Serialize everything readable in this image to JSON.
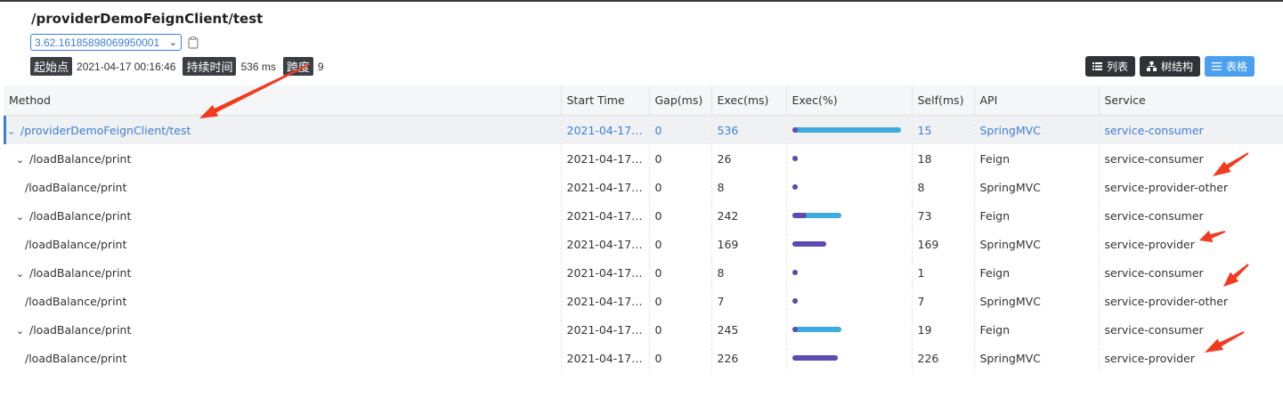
{
  "trace": {
    "title": "/providerDemoFeignClient/test",
    "trace_id": "3.62.16185898069950001",
    "start_label": "起始点",
    "start_value": "2021-04-17 00:16:46",
    "duration_label": "持续时间",
    "duration_value": "536 ms",
    "spans_label": "跨度",
    "spans_value": "9"
  },
  "views": {
    "list": "列表",
    "tree": "树结构",
    "table": "表格"
  },
  "columns": [
    "Method",
    "Start Time",
    "Gap(ms)",
    "Exec(ms)",
    "Exec(%)",
    "Self(ms)",
    "API",
    "Service"
  ],
  "rows": [
    {
      "method": "/providerDemoFeignClient/test",
      "expandable": true,
      "indent": 0,
      "start": "2021-04-17 0...",
      "gap": "0",
      "exec": "536",
      "exec_pct": 100,
      "self_pct": 2.8,
      "self": "15",
      "api": "SpringMVC",
      "service": "service-consumer",
      "selected": true
    },
    {
      "method": "/loadBalance/print",
      "expandable": true,
      "indent": 1,
      "start": "2021-04-17 0...",
      "gap": "0",
      "exec": "26",
      "exec_pct": 4.9,
      "self_pct": 3.4,
      "self": "18",
      "api": "Feign",
      "service": "service-consumer"
    },
    {
      "method": "/loadBalance/print",
      "expandable": false,
      "indent": 2,
      "start": "2021-04-17 0...",
      "gap": "0",
      "exec": "8",
      "exec_pct": 1.5,
      "self_pct": 1.5,
      "self": "8",
      "api": "SpringMVC",
      "service": "service-provider-other"
    },
    {
      "method": "/loadBalance/print",
      "expandable": true,
      "indent": 1,
      "start": "2021-04-17 0...",
      "gap": "0",
      "exec": "242",
      "exec_pct": 45.1,
      "self_pct": 13.6,
      "self": "73",
      "api": "Feign",
      "service": "service-consumer"
    },
    {
      "method": "/loadBalance/print",
      "expandable": false,
      "indent": 2,
      "start": "2021-04-17 0...",
      "gap": "0",
      "exec": "169",
      "exec_pct": 31.5,
      "self_pct": 31.5,
      "self": "169",
      "api": "SpringMVC",
      "service": "service-provider"
    },
    {
      "method": "/loadBalance/print",
      "expandable": true,
      "indent": 1,
      "start": "2021-04-17 0...",
      "gap": "0",
      "exec": "8",
      "exec_pct": 1.5,
      "self_pct": 0.2,
      "self": "1",
      "api": "Feign",
      "service": "service-consumer"
    },
    {
      "method": "/loadBalance/print",
      "expandable": false,
      "indent": 2,
      "start": "2021-04-17 0...",
      "gap": "0",
      "exec": "7",
      "exec_pct": 1.3,
      "self_pct": 1.3,
      "self": "7",
      "api": "SpringMVC",
      "service": "service-provider-other"
    },
    {
      "method": "/loadBalance/print",
      "expandable": true,
      "indent": 1,
      "start": "2021-04-17 0...",
      "gap": "0",
      "exec": "245",
      "exec_pct": 45.7,
      "self_pct": 3.5,
      "self": "19",
      "api": "Feign",
      "service": "service-consumer"
    },
    {
      "method": "/loadBalance/print",
      "expandable": false,
      "indent": 2,
      "start": "2021-04-17 0...",
      "gap": "0",
      "exec": "226",
      "exec_pct": 42.2,
      "self_pct": 42.2,
      "self": "226",
      "api": "SpringMVC",
      "service": "service-provider"
    }
  ],
  "colors": {
    "accent": "#3d7fd8",
    "bar_total": "#3eaadd",
    "bar_self": "#5e4bb0",
    "annotation_arrow": "#f23a1f",
    "tag_bg": "#3b3f44",
    "active_view": "#4aa0ef"
  }
}
